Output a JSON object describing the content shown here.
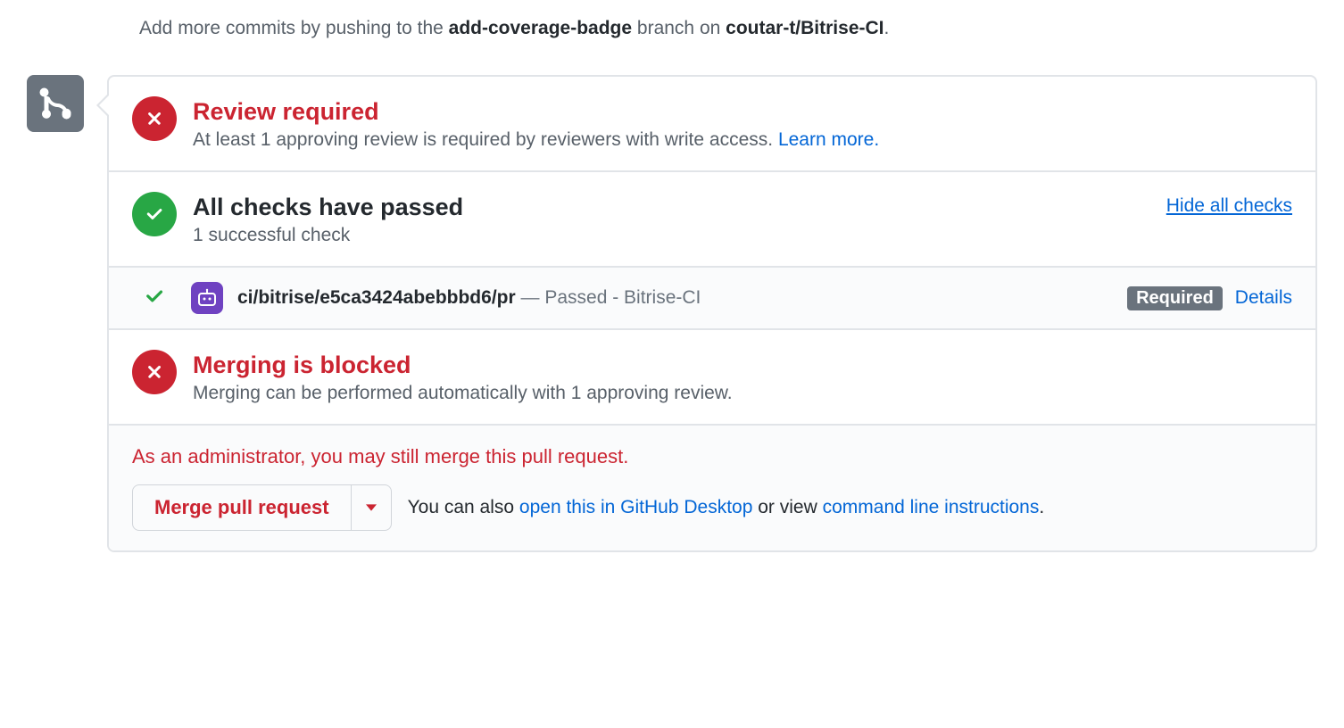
{
  "hint": {
    "prefix": "Add more commits by pushing to the ",
    "branch": "add-coverage-badge",
    "middle": " branch on ",
    "repo": "coutar-t/Bitrise-CI",
    "suffix": "."
  },
  "review": {
    "title": "Review required",
    "subtitle_prefix": "At least 1 approving review is required by reviewers with write access. ",
    "learn_more": "Learn more."
  },
  "checks": {
    "title": "All checks have passed",
    "subtitle": "1 successful check",
    "toggle": "Hide all checks"
  },
  "check_item": {
    "name": "ci/bitrise/e5ca3424abebbbd6/pr",
    "sep": " — ",
    "status": "Passed - Bitrise-CI",
    "required": "Required",
    "details": "Details"
  },
  "blocked": {
    "title": "Merging is blocked",
    "subtitle": "Merging can be performed automatically with 1 approving review."
  },
  "footer": {
    "admin_note": "As an administrator, you may still merge this pull request.",
    "merge_label": "Merge pull request",
    "also_prefix": "You can also ",
    "desktop_link": "open this in GitHub Desktop",
    "or_view": " or view ",
    "cli_link": "command line instructions",
    "period": "."
  }
}
